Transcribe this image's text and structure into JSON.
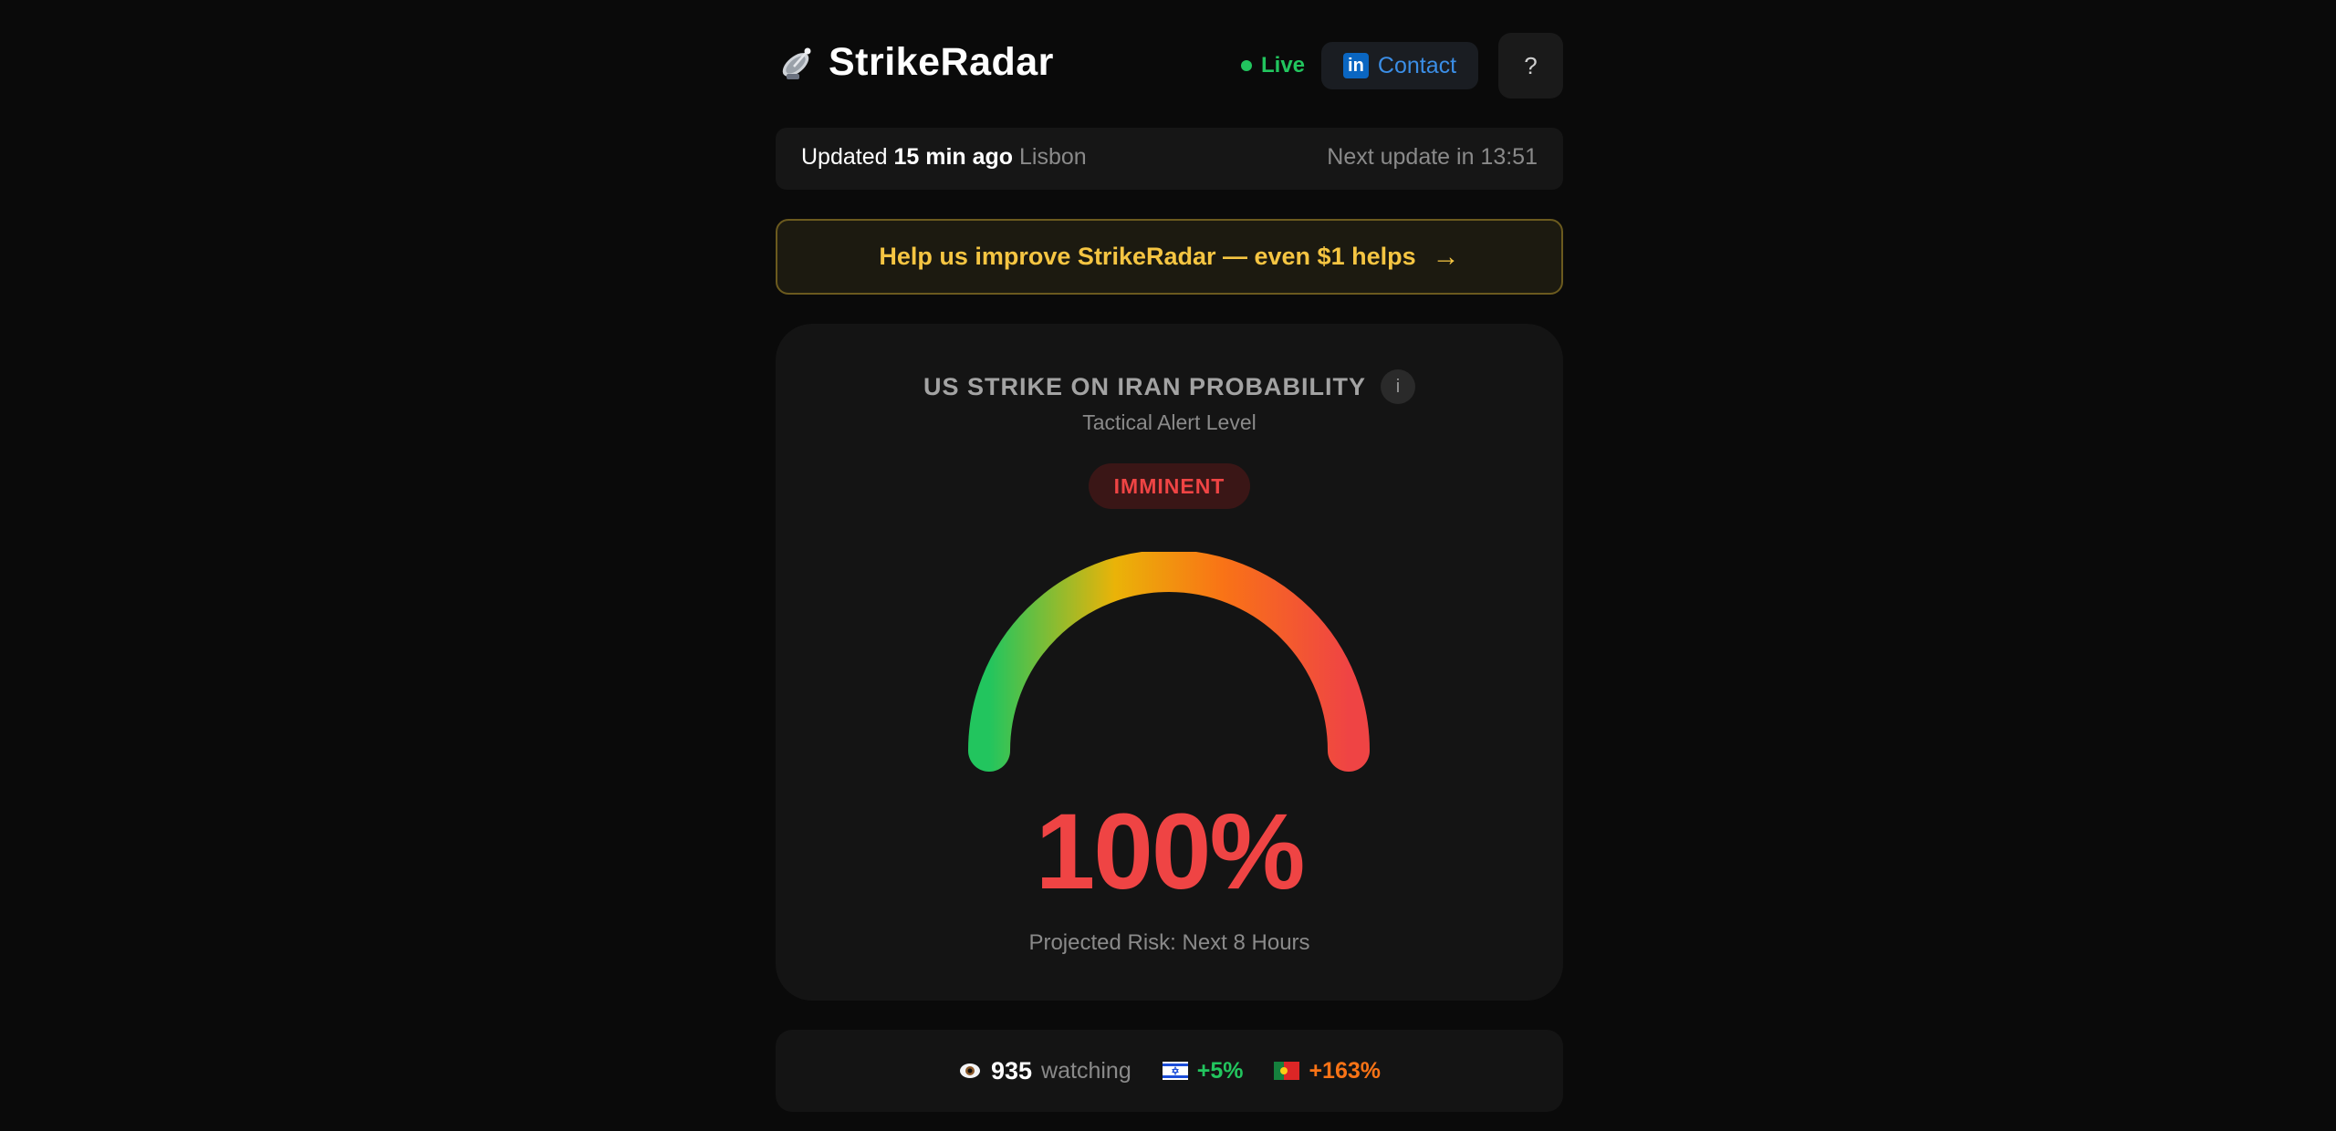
{
  "header": {
    "brand": "StrikeRadar",
    "brand_icon": "satellite-dish-icon",
    "live_label": "Live",
    "contact_label": "Contact",
    "contact_icon": "linkedin-icon",
    "help_label": "?"
  },
  "update_bar": {
    "prefix": "Updated",
    "age": "15 min ago",
    "city": "Lisbon",
    "next_update": "Next update in 13:51"
  },
  "donate": {
    "text": "Help us improve StrikeRadar — even $1 helps",
    "arrow": "→"
  },
  "card": {
    "title": "US STRIKE ON IRAN PROBABILITY",
    "info_label": "i",
    "subtitle": "Tactical Alert Level",
    "badge": "IMMINENT",
    "percent": "100%",
    "gauge_level": 1.0,
    "risk_label": "Projected Risk: Next 8 Hours"
  },
  "stats": {
    "watch_icon": "eye-icon",
    "watch_count": "935",
    "watch_label": "watching",
    "israel_delta": "+5%",
    "portugal_delta": "+163%"
  },
  "colors": {
    "accent_red": "#ef4444",
    "live_green": "#22c55e",
    "donate_gold": "#f5c542",
    "contact_blue": "#3b8ee6"
  }
}
